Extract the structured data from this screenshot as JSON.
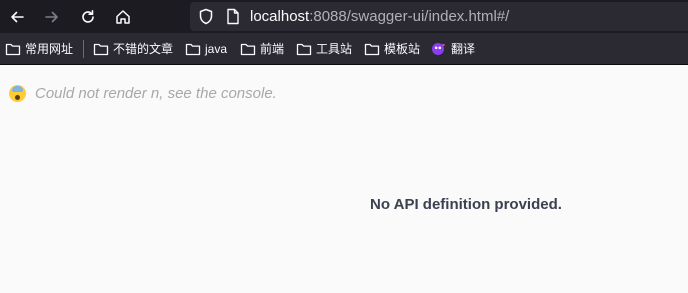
{
  "browser": {
    "url_host": "localhost",
    "url_rest": ":8088/swagger-ui/index.html#/"
  },
  "bookmarks": [
    {
      "label": "常用网址",
      "icon": "folder-icon"
    },
    {
      "label": "不错的文章",
      "icon": "folder-icon"
    },
    {
      "label": "java",
      "icon": "folder-icon"
    },
    {
      "label": "前端",
      "icon": "folder-icon"
    },
    {
      "label": "工具站",
      "icon": "folder-icon"
    },
    {
      "label": "模板站",
      "icon": "folder-icon"
    },
    {
      "label": "翻译",
      "icon": "translate-icon"
    }
  ],
  "page": {
    "error_message": "Could not render n, see the console.",
    "empty_message": "No API definition provided."
  },
  "colors": {
    "toolbar_bg": "#1c1b22",
    "bookmarks_bg": "#2b2a33",
    "content_bg": "#fafafa",
    "error_text": "#a8a8a8",
    "empty_text": "#3b4151"
  }
}
